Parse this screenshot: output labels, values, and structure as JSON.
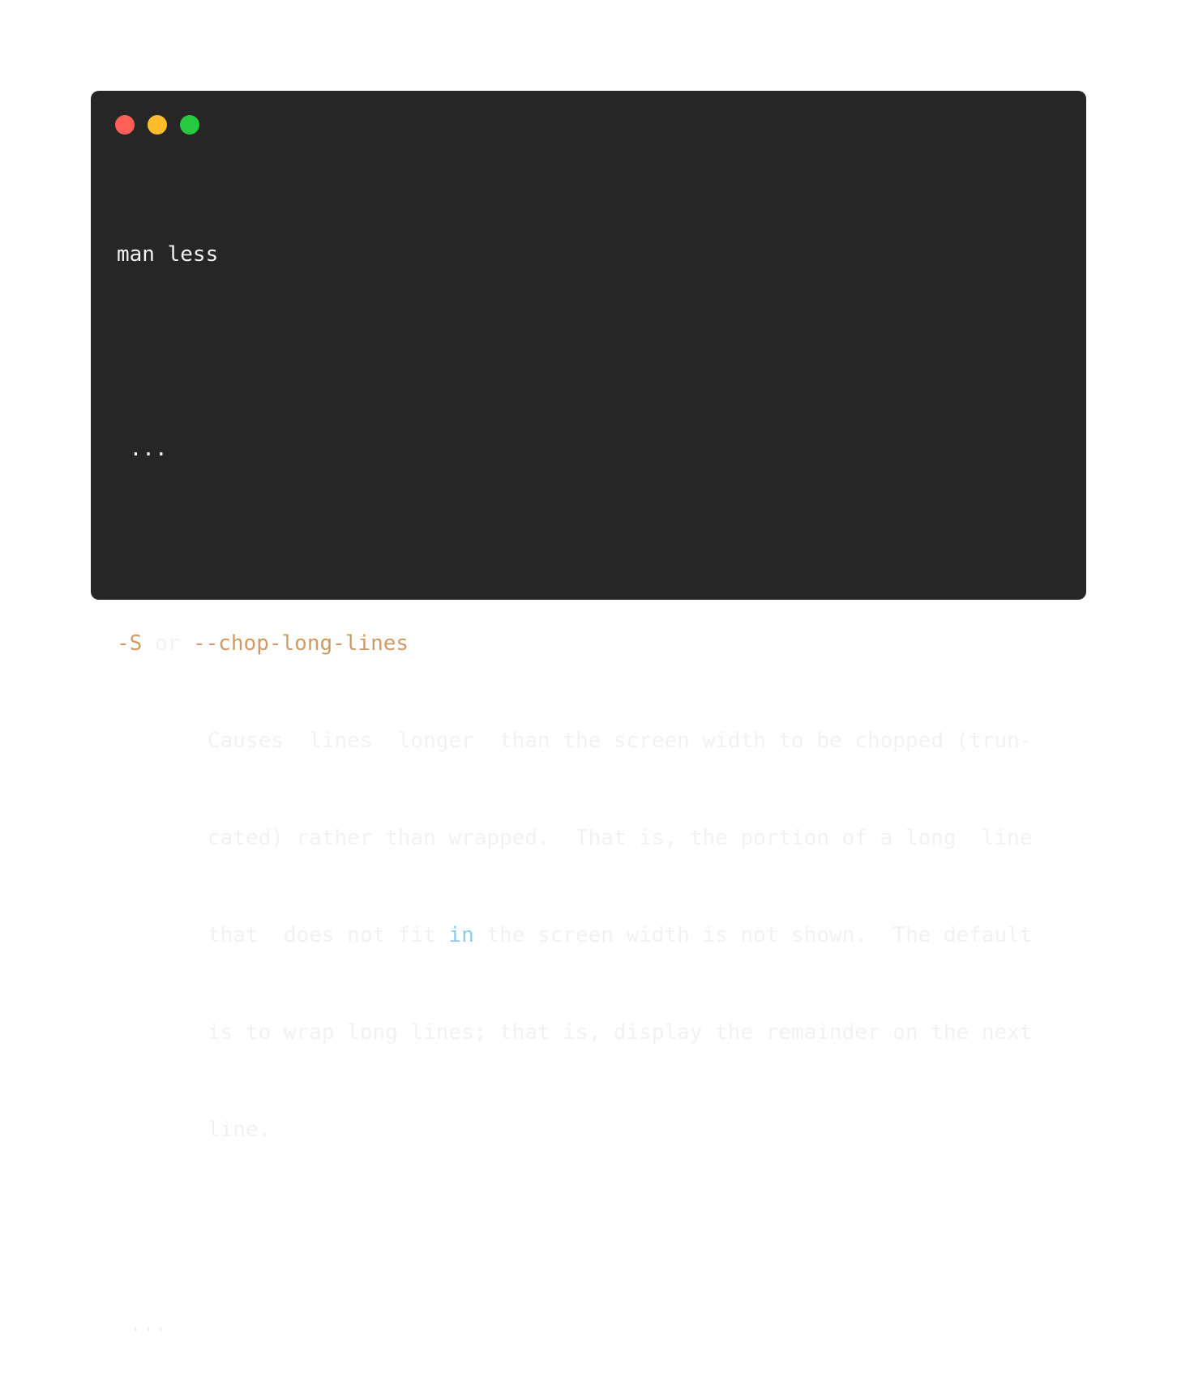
{
  "window": {
    "controls": {
      "close_color": "#ff5f56",
      "minimize_color": "#ffbd2e",
      "maximize_color": "#27c93f"
    }
  },
  "terminal": {
    "command": "man less",
    "ellipsis_top": "...",
    "option_short": "-S",
    "option_or": " or ",
    "option_long": "--chop-long-lines",
    "desc_line1": "Causes  lines  longer  than the screen width to be chopped (trun-",
    "desc_line2": "cated) rather than wrapped.  That is, the portion of a long  line",
    "desc_line3_a": "that  does not fit ",
    "desc_line3_kw": "in",
    "desc_line3_b": " the screen width is not shown.  The default",
    "desc_line4": "is to wrap long lines; that is, display the remainder on the next",
    "desc_line5": "line.",
    "ellipsis_bottom": "..."
  }
}
